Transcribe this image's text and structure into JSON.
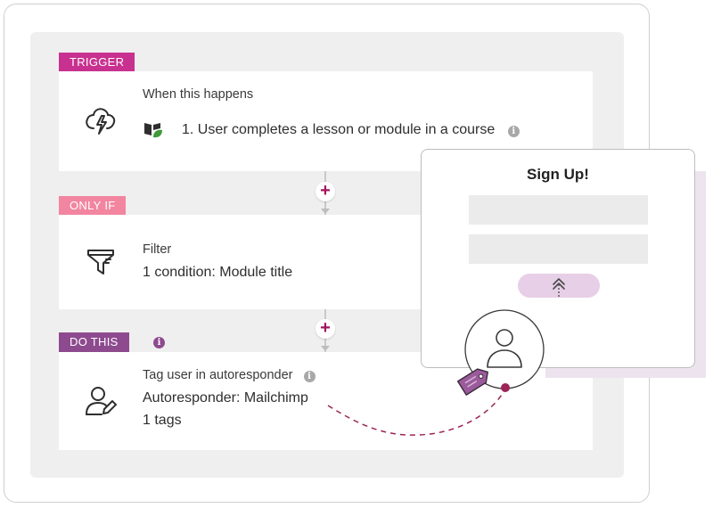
{
  "steps": {
    "trigger": {
      "badge": "TRIGGER",
      "heading": "When this happens",
      "description": "1. User completes a lesson or module in a course",
      "icon": "lightning-icon",
      "app_icon": "book-leaf-icon"
    },
    "only_if": {
      "badge": "ONLY IF",
      "heading": "Filter",
      "description": "1 condition: Module title",
      "icon": "funnel-icon"
    },
    "do_this": {
      "badge": "DO THIS",
      "heading": "Tag user in autoresponder",
      "description": "Autoresponder: Mailchimp",
      "detail": "1 tags",
      "icon": "user-edit-icon"
    }
  },
  "info_glyph": "i",
  "add_glyph": "+",
  "signup": {
    "title": "Sign Up!"
  },
  "colors": {
    "trigger": "#c8318f",
    "only_if": "#f2859f",
    "do_this": "#8e4a8e",
    "accent": "#a3155f"
  }
}
